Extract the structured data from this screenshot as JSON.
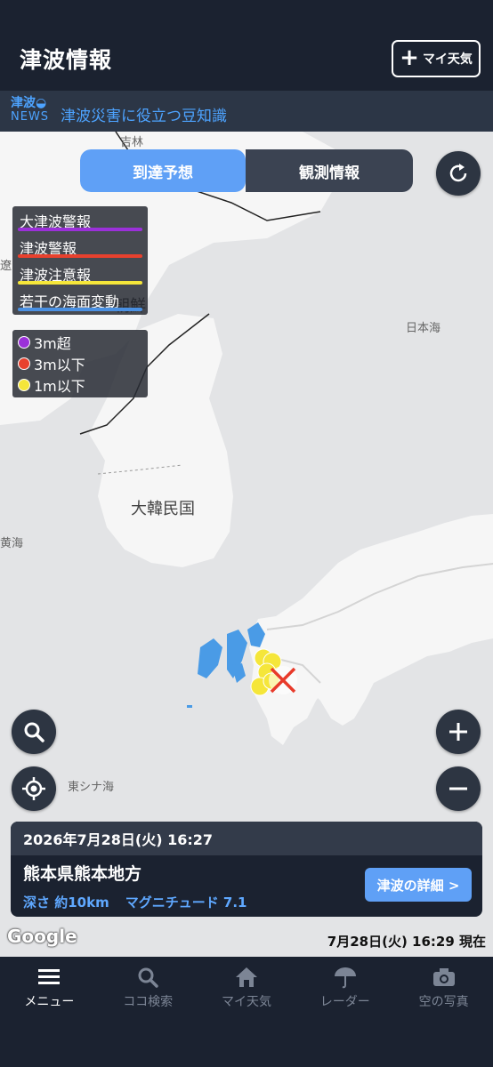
{
  "header": {
    "title": "津波情報",
    "my_weather_label": "マイ天気"
  },
  "newsbar": {
    "logo_line1": "津波",
    "logo_line2": "NEWS",
    "text": "津波災害に役立つ豆知識"
  },
  "map": {
    "labels": {
      "jilin": "吉林",
      "sea_of_japan": "日本海",
      "south_korea": "大韓民国",
      "north_korea": "朝鮮",
      "east_china_sea": "東シナ海",
      "yellow_sea": "黄海",
      "liaoning": "遼"
    },
    "google": "Google",
    "timestamp": "7月28日(火) 16:29 現在"
  },
  "toggle": {
    "active": "到達予想",
    "inactive": "観測情報"
  },
  "legend_lines": [
    {
      "label": "大津波警報",
      "color": "#9b30d9"
    },
    {
      "label": "津波警報",
      "color": "#e8412e"
    },
    {
      "label": "津波注意報",
      "color": "#f5e63a"
    },
    {
      "label": "若干の海面変動",
      "color": "#4a90e2"
    }
  ],
  "legend_dots": [
    {
      "label": "3m超",
      "color": "#9b30d9"
    },
    {
      "label": "3m以下",
      "color": "#e8412e"
    },
    {
      "label": "1m以下",
      "color": "#f5e63a"
    }
  ],
  "card": {
    "datetime": "2026年7月28日(火) 16:27",
    "place": "熊本県熊本地方",
    "depth": "深さ 約10km",
    "magnitude": "マグニチュード 7.1",
    "detail_button": "津波の詳細 >"
  },
  "nav": [
    {
      "label": "メニュー",
      "icon": "menu-icon",
      "active": true
    },
    {
      "label": "ココ検索",
      "icon": "search-icon",
      "active": false
    },
    {
      "label": "マイ天気",
      "icon": "home-icon",
      "active": false
    },
    {
      "label": "レーダー",
      "icon": "radar-umbrella-icon",
      "active": false
    },
    {
      "label": "空の写真",
      "icon": "camera-icon",
      "active": false
    }
  ]
}
